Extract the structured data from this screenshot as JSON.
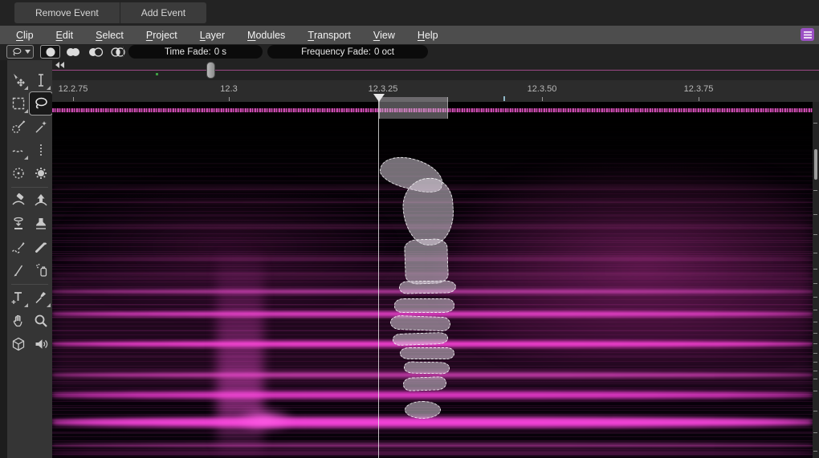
{
  "event_bar": {
    "buttons": [
      {
        "label": "Remove Event"
      },
      {
        "label": "Add Event"
      }
    ]
  },
  "menubar": {
    "items": [
      {
        "mnemonic": "C",
        "rest": "lip"
      },
      {
        "mnemonic": "E",
        "rest": "dit"
      },
      {
        "mnemonic": "S",
        "rest": "elect"
      },
      {
        "mnemonic": "P",
        "rest": "roject"
      },
      {
        "mnemonic": "L",
        "rest": "ayer"
      },
      {
        "mnemonic": "M",
        "rest": "odules"
      },
      {
        "mnemonic": "T",
        "rest": "ransport"
      },
      {
        "mnemonic": "V",
        "rest": "iew"
      },
      {
        "mnemonic": "H",
        "rest": "elp"
      }
    ]
  },
  "toolbar": {
    "selection_tool": "lasso",
    "modes": [
      "new-selection",
      "add-to-selection",
      "subtract-from-selection",
      "intersect-selection"
    ],
    "active_mode": "new-selection",
    "time_fade": {
      "label": "Time Fade:",
      "value": "0 s"
    },
    "frequency_fade": {
      "label": "Frequency Fade:",
      "value": "0 oct"
    }
  },
  "sidebar": {
    "active_tool": "lasso",
    "tools": [
      "move",
      "ibeam-cursor",
      "rectangle-select",
      "lasso",
      "selection-brush",
      "magic-wand",
      "horizontal-band-select",
      "vertical-band-select",
      "dotted-circle-select",
      "burst-select",
      "eraser",
      "extract-up",
      "press-down",
      "clone-stamp",
      "heal",
      "marker",
      "knife",
      "spray",
      "text",
      "eyedropper",
      "hand-pan",
      "zoom",
      "cube-3d",
      "audio-speaker"
    ]
  },
  "timeline": {
    "ticks": [
      {
        "label": "12.2.75"
      },
      {
        "label": "12.3"
      },
      {
        "label": "12.3.25"
      },
      {
        "label": "12.3.50"
      },
      {
        "label": "12.3.75"
      }
    ],
    "playhead_position": "12.3.25"
  },
  "icons": {
    "layers-icon": "stacked-layers on purple square",
    "rewind-icon": "double left triangles",
    "caret-down-icon": "▾"
  },
  "colors": {
    "accent_magenta": "#ff3ddc",
    "spectrogram_mid": "#7a2a68",
    "selection_fill": "rgba(222,212,224,0.52)",
    "layers_icon_bg": "#9b50c4",
    "menubar_bg": "#4d4d4d",
    "playhead": "#fafafa"
  }
}
